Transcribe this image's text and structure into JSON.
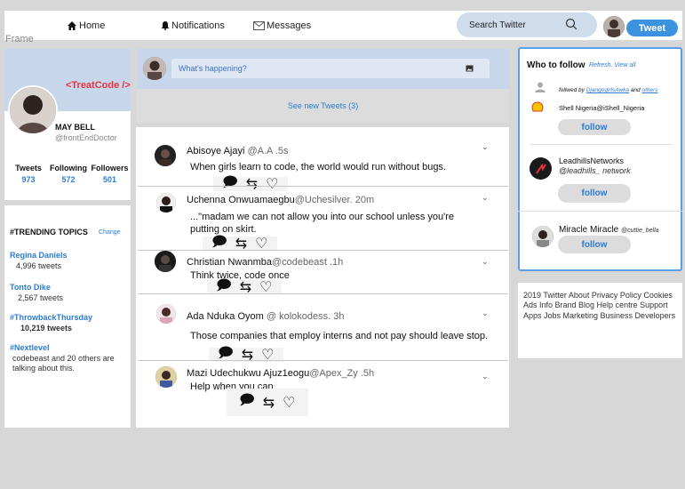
{
  "nav": {
    "home_label": "Home",
    "notifications_label": "Notifications",
    "messages_label": "Messages",
    "search_placeholder": "Search Twitter",
    "tweet_button": "Tweet"
  },
  "frame_label": "Frame",
  "profile": {
    "brand": "<TreatCode />",
    "name": "MAY   BELL",
    "handle": "@frontEndDoctor",
    "stats": [
      {
        "label": "Tweets",
        "value": "973"
      },
      {
        "label": "Following",
        "value": "572"
      },
      {
        "label": "Followers",
        "value": "501"
      }
    ]
  },
  "trending": {
    "title": "#TRENDING TOPICS",
    "change": "Change",
    "items": [
      {
        "name": "Regina Daniels",
        "sub": "4,996 tweets"
      },
      {
        "name": "Tonto   Dike",
        "sub": "2,567 tweets"
      },
      {
        "name": "#ThrowbackThursday",
        "sub": "10,219 tweets"
      },
      {
        "name": "#Nextlevel",
        "sub": "codebeast and 20 others are talking about this."
      }
    ]
  },
  "composer": {
    "placeholder": "What's happening?",
    "new_tweets": "See  new Tweets (3)"
  },
  "tweets": [
    {
      "name": "Abisoye Ajayi",
      "handle": "@A.A .5s",
      "text": "When girls learn to code, the world would run without  bugs."
    },
    {
      "name": "Uchenna Onwuamaegbu",
      "handle": "@Uchesilver. 20m",
      "text": "...\"madam we can not allow you into our school  unless you're putting  on skirt."
    },
    {
      "name": "Christian Nwanmba",
      "handle": "@codebeast .1h",
      "text": "Think twice, code once"
    },
    {
      "name": "Ada Nduka Oyom",
      "handle": "@ kolokodess. 3h",
      "text": "Those companies that employ interns  and not pay should leave stop."
    },
    {
      "name": "Mazi Udechukwu Ajuz1eogu",
      "handle": "@Apex_Zy .5h",
      "text": "Help when you can"
    }
  ],
  "who_to_follow": {
    "title": "Who to follow",
    "links": "Refresh. View all",
    "followed_by_prefix": "follwed by ",
    "followed_by_user": "DjangogirlsAwka",
    "followed_by_and": " and ",
    "followed_by_others": "others",
    "suggestions": [
      {
        "name": "Shell Nigeria@iShell_Nigeria",
        "handle": "",
        "button": "follow"
      },
      {
        "name": "LeadhillsNetworks",
        "handle": "@leadhills_ network",
        "button": "follow"
      },
      {
        "name": "Miracle  Miracle",
        "handle": "@cuttie_bella",
        "button": "follow"
      }
    ]
  },
  "footer": {
    "text": "2019 Twitter About Privacy Policy Cookies Ads Info Brand Blog Help centre Support Apps Jobs Marketing Business Developers"
  },
  "colors": {
    "accent": "#3b93e0",
    "brand_red": "#e8323c",
    "link_blue": "#2b7cd3"
  }
}
